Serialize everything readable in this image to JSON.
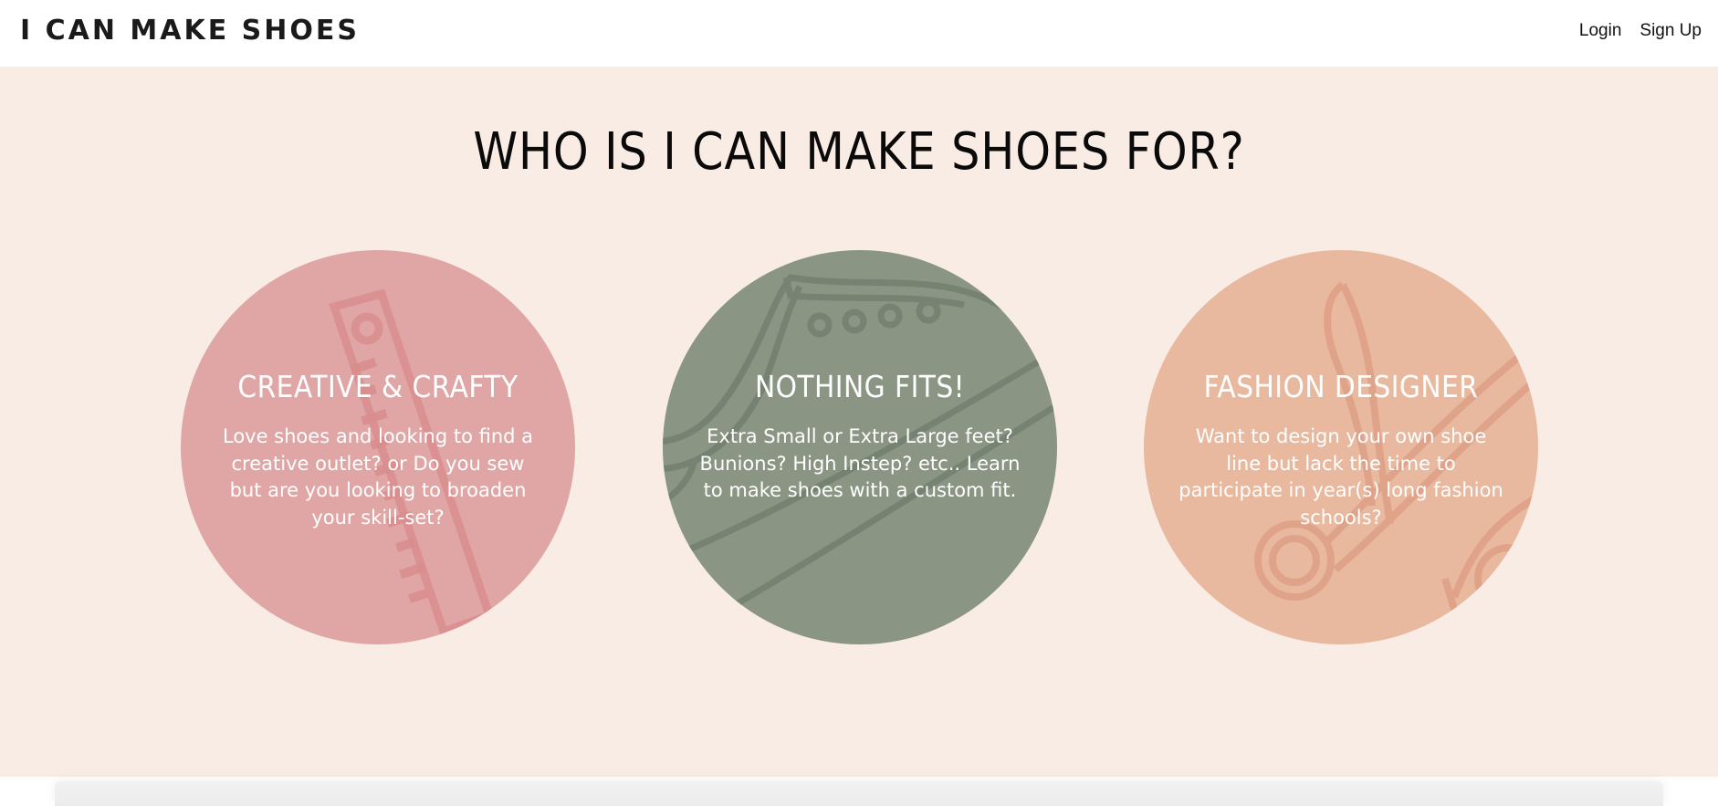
{
  "header": {
    "logo": "I CAN MAKE SHOES",
    "nav": {
      "login": "Login",
      "signup": "Sign Up"
    }
  },
  "section": {
    "title": "WHO IS I CAN MAKE SHOES FOR?",
    "cards": [
      {
        "title": "CREATIVE & CRAFTY",
        "text": "Love shoes and looking to find a creative outlet? or Do you sew but are you looking to broaden your skill-set?",
        "icon": "ruler-icon",
        "color": "#e0a6a5"
      },
      {
        "title": "NOTHING FITS!",
        "text": "Extra Small or Extra Large feet? Bunions? High Instep? etc.. Learn to make shoes with a custom fit.",
        "icon": "shoe-icon",
        "color": "#8a9583"
      },
      {
        "title": "FASHION DESIGNER",
        "text": "Want to design your own shoe line but lack the time to participate in year(s) long fashion schools?",
        "icon": "scissors-icon",
        "color": "#e8b99f"
      }
    ]
  },
  "colors": {
    "section_background": "#f9ece4",
    "header_background": "#ffffff"
  }
}
